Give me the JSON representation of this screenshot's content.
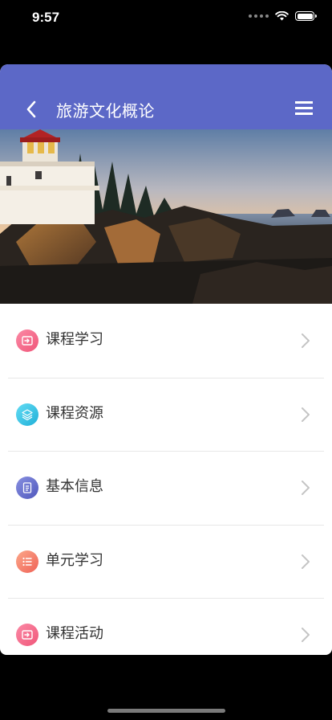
{
  "status_bar": {
    "time": "9:57"
  },
  "nav": {
    "title": "旅游文化概论",
    "back_icon": "chevron-left-icon",
    "menu_icon": "hamburger-menu-icon"
  },
  "hero": {
    "description": "lighthouse-on-rocky-coast-at-sunset"
  },
  "menu": {
    "items": [
      {
        "label": "课程学习",
        "icon": "folder-arrow-icon",
        "color_from": "#f9789a",
        "color_to": "#f2607f"
      },
      {
        "label": "课程资源",
        "icon": "layers-icon",
        "color_from": "#5fd3f0",
        "color_to": "#27b6dd"
      },
      {
        "label": "基本信息",
        "icon": "document-icon",
        "color_from": "#7c84d9",
        "color_to": "#5a64c4"
      },
      {
        "label": "单元学习",
        "icon": "list-icon",
        "color_from": "#fb9a7e",
        "color_to": "#f26b5b"
      },
      {
        "label": "课程活动",
        "icon": "folder-arrow-icon",
        "color_from": "#f9789a",
        "color_to": "#f2607f"
      }
    ]
  },
  "colors": {
    "nav_bg": "#5c68c7",
    "background": "#000000",
    "sheet": "#ffffff"
  }
}
